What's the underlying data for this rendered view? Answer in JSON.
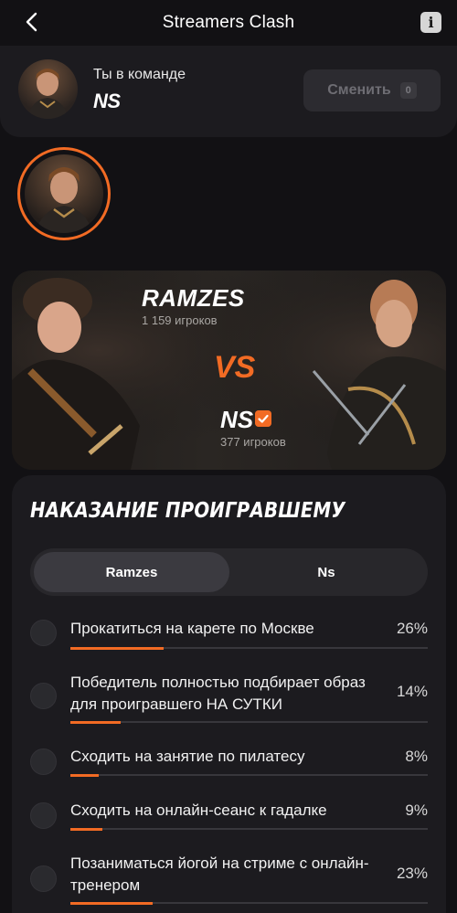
{
  "header": {
    "title": "Streamers Clash"
  },
  "team": {
    "label": "Ты в команде",
    "name": "NS",
    "change_label": "Сменить",
    "change_count": "0"
  },
  "vs": {
    "team1": {
      "name": "RAMZES",
      "players": "1 159 игроков"
    },
    "vs_label": "VS",
    "team2": {
      "name": "NS",
      "players": "377 игроков"
    }
  },
  "punishment": {
    "title": "НАКАЗАНИЕ ПРОИГРАВШЕМУ",
    "tabs": [
      {
        "label": "Ramzes"
      },
      {
        "label": "Ns"
      }
    ],
    "options": [
      {
        "text": "Прокатиться на карете по Москве",
        "pct": "26%",
        "value": 26
      },
      {
        "text": "Победитель полностью подбирает образ для проигравшего НА СУТКИ",
        "pct": "14%",
        "value": 14
      },
      {
        "text": "Сходить на занятие по пилатесу",
        "pct": "8%",
        "value": 8
      },
      {
        "text": "Сходить на онлайн-сеанс к гадалке",
        "pct": "9%",
        "value": 9
      },
      {
        "text": "Позаниматься йогой на стриме с онлайн-тренером",
        "pct": "23%",
        "value": 23
      }
    ]
  },
  "colors": {
    "accent": "#f26b24",
    "background": "#121114",
    "card": "#1c1b1f"
  }
}
